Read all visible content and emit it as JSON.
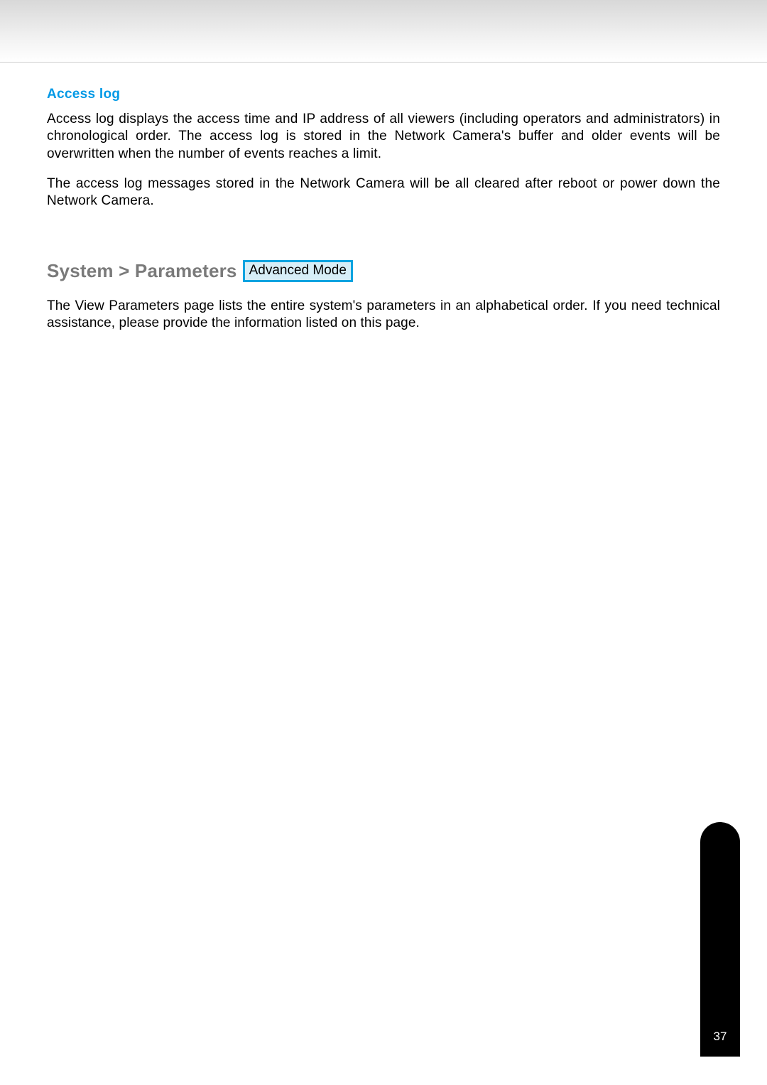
{
  "section1": {
    "title": "Access log",
    "paragraph1": "Access log displays the access time and IP address of all viewers (including operators and administrators) in chronological order. The access log is stored in the Network Camera's buffer and older events will be overwritten when the number of events reaches a limit.",
    "paragraph2": "The access log messages stored in the Network Camera will be all cleared after reboot or power down the Network Camera."
  },
  "section2": {
    "breadcrumb": "System > Parameters",
    "badge": "Advanced Mode",
    "paragraph1": "The View Parameters page lists the entire system's parameters in an alphabetical order. If you need technical assistance, please provide the information listed on this page."
  },
  "footer": {
    "page_number": "37"
  }
}
